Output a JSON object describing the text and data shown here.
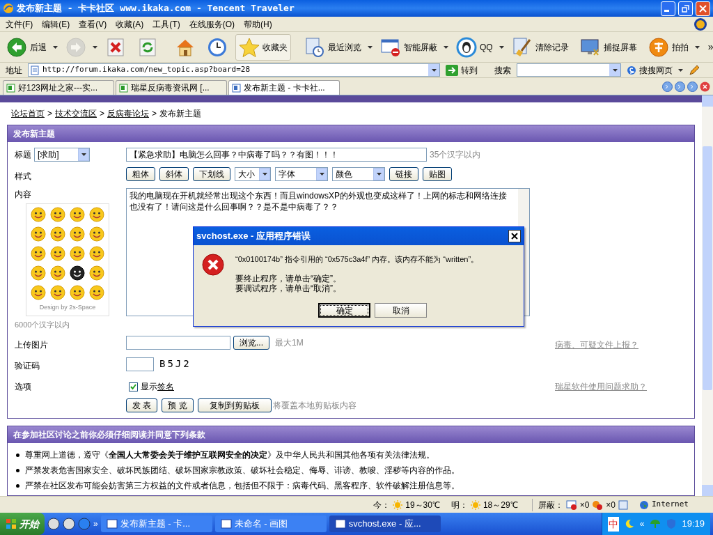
{
  "window": {
    "title": "发布新主题 - 卡卡社区 www.ikaka.com - Tencent Traveler"
  },
  "menu": [
    "文件(F)",
    "编辑(E)",
    "查看(V)",
    "收藏(A)",
    "工具(T)",
    "在线服务(O)",
    "帮助(H)"
  ],
  "toolbar": [
    {
      "kind": "back",
      "label": "后退",
      "dropdown": true,
      "disabled": false
    },
    {
      "kind": "forward",
      "dropdown": true,
      "disabled": true
    },
    {
      "kind": "stop",
      "disabled": false
    },
    {
      "kind": "refresh",
      "disabled": false
    },
    {
      "kind": "home",
      "disabled": false
    },
    {
      "kind": "history",
      "disabled": false
    },
    {
      "kind": "favorites",
      "label": "收藏夹",
      "pressed": true,
      "disabled": false
    },
    {
      "kind": "recent",
      "label": "最近浏览",
      "dropdown": true,
      "disabled": false
    },
    {
      "kind": "block",
      "label": "智能屏蔽",
      "dropdown": true,
      "disabled": false
    },
    {
      "kind": "qq",
      "label": "QQ",
      "dropdown": true,
      "disabled": false
    },
    {
      "kind": "clear",
      "label": "清除记录",
      "disabled": false
    },
    {
      "kind": "capture",
      "label": "捕捉屏幕",
      "disabled": false
    },
    {
      "kind": "paipai",
      "label": "拍拍",
      "dropdown": true,
      "disabled": false
    }
  ],
  "toolbar_more": "»",
  "address": {
    "label": "地址",
    "url": "http://forum.ikaka.com/new_topic.asp?board=28",
    "go": "转到"
  },
  "search": {
    "label": "搜索",
    "engine": "搜搜网页"
  },
  "tabs": [
    {
      "label": "好123网址之家---实...",
      "selected": false
    },
    {
      "label": "瑞星反病毒资讯网 [...",
      "selected": false
    },
    {
      "label": "发布新主题 - 卡卡社...",
      "selected": true
    }
  ],
  "breadcrumb": [
    "论坛首页",
    "技术交流区",
    "反病毒论坛",
    "发布新主题"
  ],
  "breadcrumb_separators": [
    ">",
    ">",
    ">"
  ],
  "form": {
    "title": "发布新主题",
    "subject": {
      "label": "标题",
      "type": "[求助]",
      "value": "【紧急求助】电脑怎么回事？中病毒了吗？？有图！！！",
      "hint": "35个汉字以内"
    },
    "style": {
      "label": "样式",
      "controls": [
        {
          "kind": "button",
          "label": "粗体"
        },
        {
          "kind": "button",
          "label": "斜体"
        },
        {
          "kind": "button",
          "label": "下划线"
        },
        {
          "kind": "select",
          "label": "大小"
        },
        {
          "kind": "select",
          "label": "字体"
        },
        {
          "kind": "select",
          "label": "颜色"
        },
        {
          "kind": "button",
          "label": "链接"
        },
        {
          "kind": "button",
          "label": "贴图"
        }
      ]
    },
    "content": {
      "label": "内容",
      "value": "我的电脑现在开机就经常出现这个东西！而且windowsXP的外观也变成这样了！上网的标志和网络连接也没有了！请问这是什么回事啊？？是不是中病毒了？？",
      "smiley_caption": "Design by 2s-Space",
      "hint": "6000个汉字以内"
    },
    "upload": {
      "label": "上传图片",
      "browse": "浏览...",
      "hint": "最大1M",
      "link": "病毒、可疑文件上报？"
    },
    "captcha": {
      "label": "验证码",
      "code": "B5J2"
    },
    "options": {
      "label": "选项",
      "checkbox": {
        "label": "显示",
        "link": "签名",
        "checked": true
      },
      "link": "瑞星软件使用问题求助？"
    },
    "buttons": [
      "发 表",
      "预 览",
      "复制到剪贴板"
    ],
    "buttons_note": "将覆盖本地剪贴板内容"
  },
  "terms": {
    "title": "在参加社区讨论之前你必须仔细阅读并同意下列条款",
    "items": [
      "尊重网上道德，遵守《**全国人大常委会关于维护互联网安全的决定**》及中华人民共和国其他各项有关法律法规。",
      "严禁发表危害国家安全、破坏民族团结、破坏国家宗教政策、破坏社会稳定、侮辱、诽谤、教唆、淫秽等内容的作品。",
      "严禁在社区发布可能会妨害第三方权益的文件或者信息，包括但不限于：病毒代码、黑客程序、软件破解注册信息等。"
    ]
  },
  "status": {
    "today_label": "今：",
    "today": "19～30℃",
    "tomorrow_label": "明：",
    "tomorrow": "18～29℃",
    "block_label": "屏蔽：",
    "popups": "×0",
    "ads": "×0",
    "zone": "Internet"
  },
  "dialog": {
    "title": "svchost.exe - 应用程序错误",
    "message": "“0x0100174b” 指令引用的 “0x575c3a4f” 内存。该内存不能为 “written”。",
    "lines": [
      "要终止程序，请单击“确定”。",
      "要调试程序，请单击“取消”。"
    ],
    "buttons": [
      {
        "label": "确定",
        "selected": true
      },
      {
        "label": "取消",
        "selected": false
      }
    ]
  },
  "taskbar": {
    "start": "开始",
    "more": "»",
    "tasks": [
      {
        "label": "发布新主题 - 卡...",
        "selected": false
      },
      {
        "label": "未命名 - 画图",
        "selected": false
      },
      {
        "label": "svchost.exe - 应...",
        "selected": true
      }
    ],
    "ime": "中",
    "clock": "19:19",
    "tray_more": "«"
  }
}
